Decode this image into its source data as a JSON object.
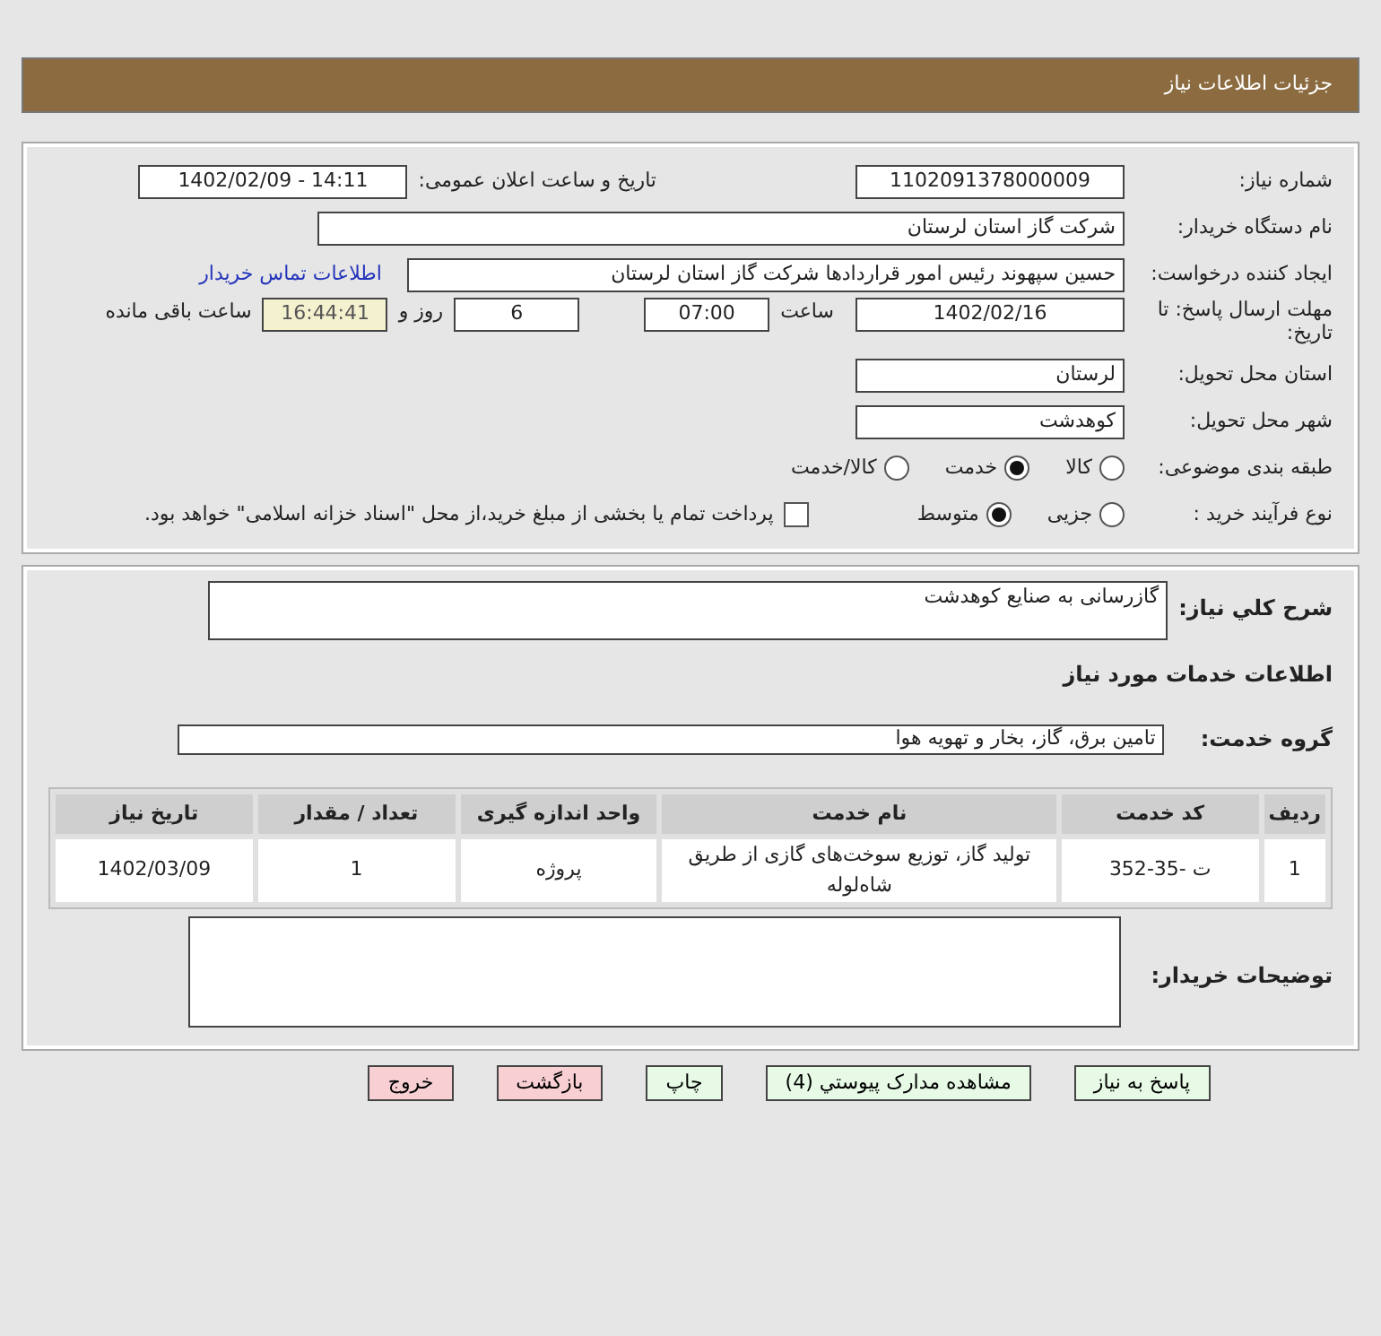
{
  "header": {
    "title": "جزئیات اطلاعات نیاز"
  },
  "need_number": {
    "label": "شماره نیاز:",
    "value": "1102091378000009"
  },
  "announce": {
    "label": "تاریخ و ساعت اعلان عمومی:",
    "value": "1402/02/09 - 14:11"
  },
  "buyer_org": {
    "label": "نام دستگاه خریدار:",
    "value": "شرکت گاز استان لرستان"
  },
  "requester": {
    "label": "ایجاد کننده درخواست:",
    "value": "حسین سپهوند رئیس امور قراردادها شرکت گاز استان لرستان",
    "link": "اطلاعات تماس خریدار"
  },
  "deadline": {
    "label": "مهلت ارسال پاسخ: تا تاریخ:",
    "date": "1402/02/16",
    "time_label": "ساعت",
    "time": "07:00",
    "days": "6",
    "days_label": "روز و",
    "remaining": "16:44:41",
    "remaining_label": "ساعت باقی مانده"
  },
  "province": {
    "label": "استان محل تحویل:",
    "value": "لرستان"
  },
  "city": {
    "label": "شهر محل تحویل:",
    "value": "کوهدشت"
  },
  "category": {
    "label": "طبقه بندی موضوعی:",
    "options": [
      {
        "label": "کالا",
        "selected": false
      },
      {
        "label": "خدمت",
        "selected": true
      },
      {
        "label": "کالا/خدمت",
        "selected": false
      }
    ]
  },
  "purchase_type": {
    "label": "نوع فرآیند خرید :",
    "options": [
      {
        "label": "جزیی",
        "selected": false
      },
      {
        "label": "متوسط",
        "selected": true
      }
    ],
    "payment": {
      "checked": false,
      "text": "پرداخت تمام یا بخشی از مبلغ خرید،از محل \"اسناد خزانه اسلامی\" خواهد بود."
    }
  },
  "description": {
    "label": "شرح کلي نياز:",
    "value": "گازرسانی به صنایع کوهدشت"
  },
  "services_heading": "اطلاعات خدمات مورد نیاز",
  "service_group": {
    "label": "گروه خدمت:",
    "value": "تامین برق، گاز، بخار و تهویه هوا"
  },
  "table": {
    "columns": [
      "ردیف",
      "کد خدمت",
      "نام خدمت",
      "واحد اندازه گیری",
      "تعداد / مقدار",
      "تاریخ نیاز"
    ],
    "rows": [
      [
        "1",
        "ت -35-352",
        "تولید گاز، توزیع سوخت‌های گازی از طریق شاه‌لوله",
        "پروژه",
        "1",
        "1402/03/09"
      ]
    ]
  },
  "buyer_notes": {
    "label": "توضیحات خریدار:"
  },
  "buttons": [
    {
      "label": "پاسخ به نیاز",
      "kind": "green"
    },
    {
      "label": "مشاهده مدارک پیوستي (4)",
      "kind": "green"
    },
    {
      "label": "چاپ",
      "kind": "green"
    },
    {
      "label": "بازگشت",
      "kind": "red"
    },
    {
      "label": "خروج",
      "kind": "red"
    }
  ]
}
